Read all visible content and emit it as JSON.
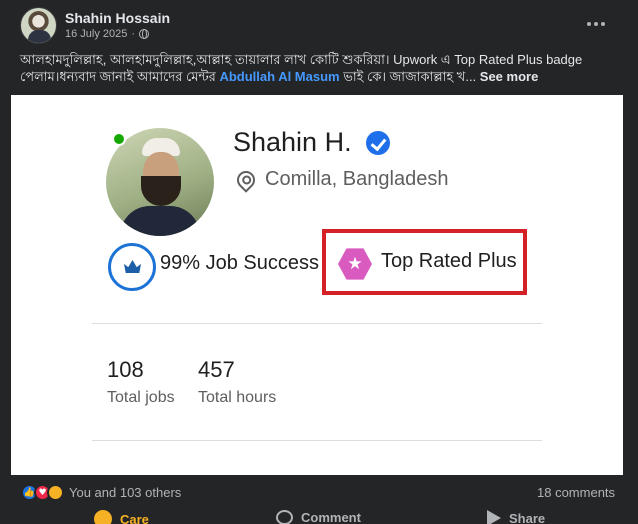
{
  "post": {
    "author": "Shahin Hossain",
    "date": "16 July 2025",
    "date_separator": "·",
    "privacy_icon": "globe-icon",
    "caption_part1": "আলহামদুলিল্লাহ, আলহামদুলিল্লাহ,আল্লাহ তায়ালার লাখ কোটি শুকরিয়া। Upwork এ Top Rated Plus badge পেলাম।ধন্যবাদ জানাই আমাদের মেন্টর ",
    "mention": "Abdullah Al Masum",
    "caption_part2": " ভাই কে। জাজাকাল্লাহ খ... ",
    "see_more": "See more"
  },
  "profile_card": {
    "name": "Shahin H.",
    "location": "Comilla, Bangladesh",
    "job_success": "99% Job Success",
    "badge": "Top Rated Plus",
    "stats": [
      {
        "value": "108",
        "label": "Total jobs"
      },
      {
        "value": "457",
        "label": "Total hours"
      }
    ]
  },
  "engagement": {
    "reactions_text": "You and 103 others",
    "comments_text": "18 comments",
    "reaction_icons": [
      "like-icon",
      "love-icon",
      "care-icon"
    ]
  },
  "actions": {
    "care": "Care",
    "comment": "Comment",
    "share": "Share"
  },
  "colors": {
    "post_bg": "#242526",
    "mention": "#4599ff",
    "highlight_box": "#d42027",
    "badge_pink": "#d95bbf",
    "online": "#14a800",
    "care_yellow": "#f7b125"
  }
}
